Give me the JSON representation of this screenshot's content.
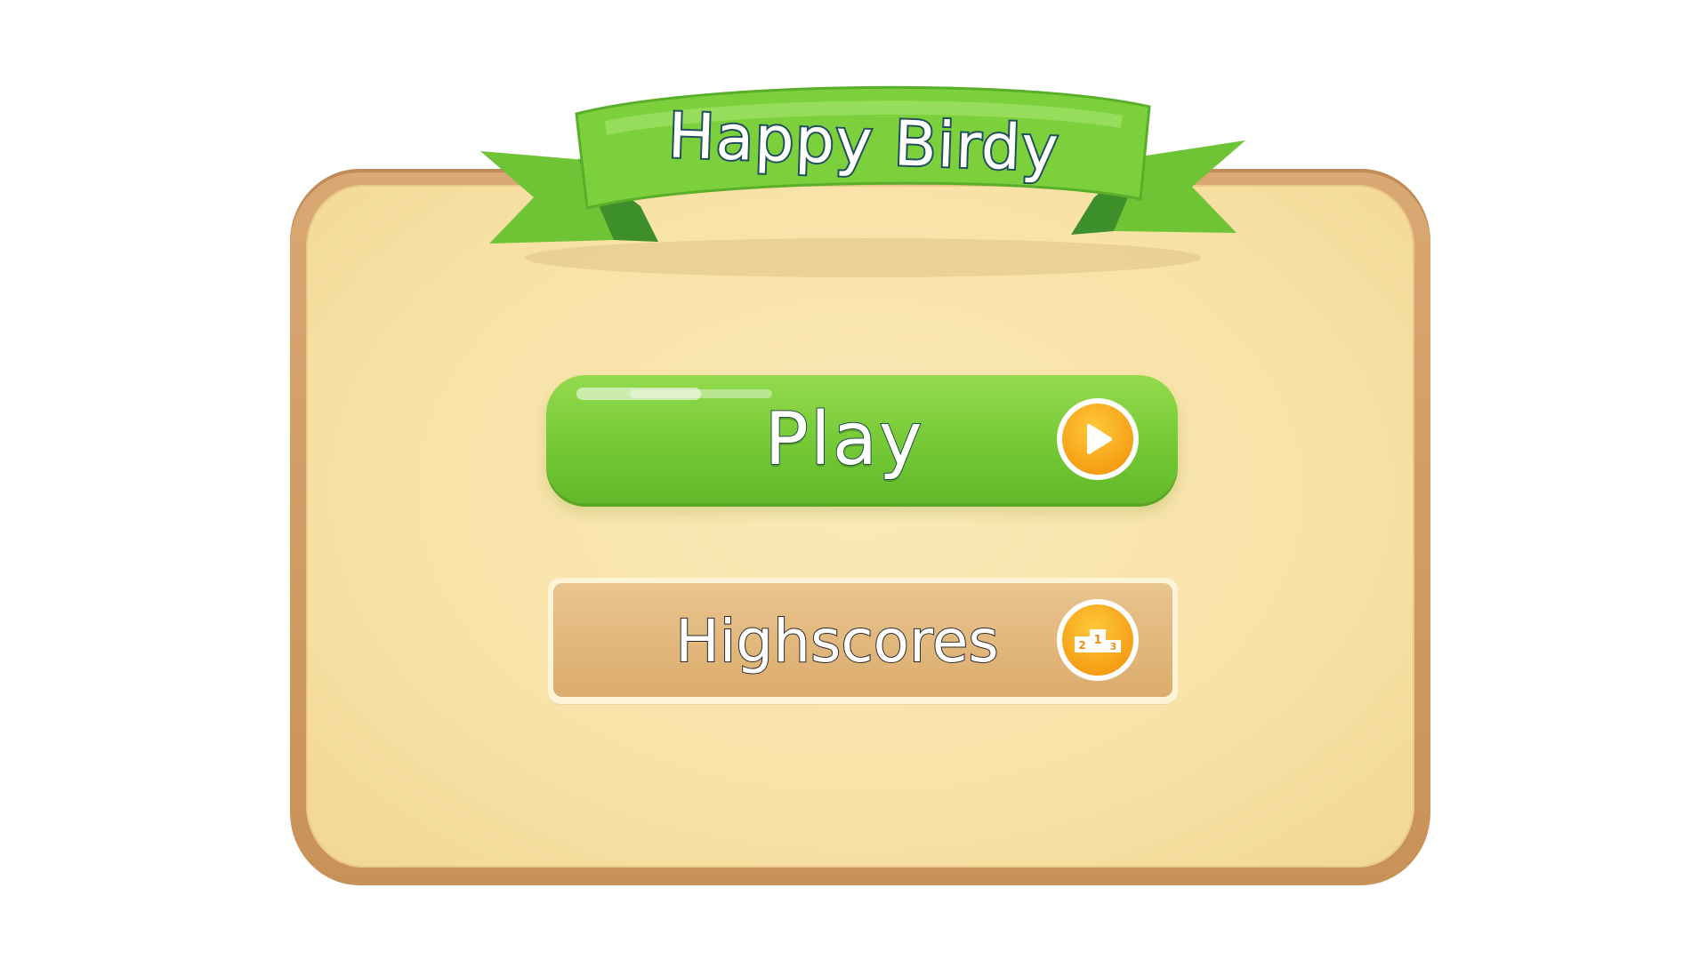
{
  "game": {
    "title": "Happy Birdy"
  },
  "menu": {
    "play_label": "Play",
    "highscores_label": "Highscores"
  },
  "icons": {
    "play": "play-triangle-icon",
    "highscores": "podium-icon",
    "podium_digits": [
      "2",
      "1",
      "3"
    ]
  },
  "colors": {
    "ribbon_green": "#78cf3a",
    "play_green": "#75c935",
    "board_wood": "#d2a06a",
    "board_parchment": "#f8e3a8",
    "badge_orange": "#f7a51a"
  }
}
